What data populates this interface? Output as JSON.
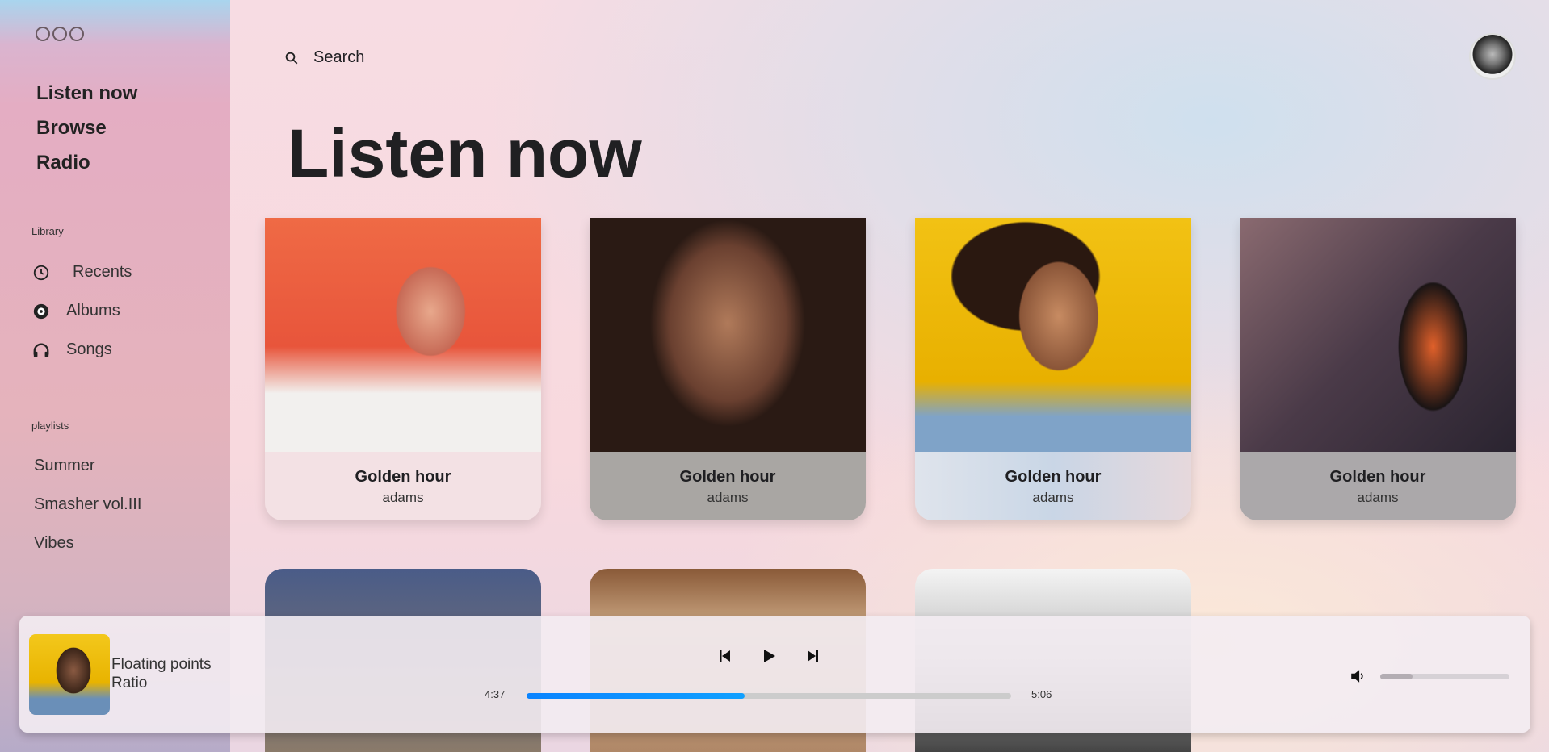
{
  "sidebar": {
    "nav": [
      "Listen now",
      "Browse",
      "Radio"
    ],
    "library_label": "Library",
    "library": [
      {
        "label": "Recents",
        "icon": "clock-icon"
      },
      {
        "label": "Albums",
        "icon": "disc-icon"
      },
      {
        "label": "Songs",
        "icon": "headphones-icon"
      }
    ],
    "playlists_label": "playlists",
    "playlists": [
      "Summer",
      "Smasher vol.III",
      "Vibes"
    ]
  },
  "header": {
    "search_label": "Search"
  },
  "main": {
    "title": "Listen now",
    "cards": [
      {
        "title": "Golden hour",
        "artist": "adams"
      },
      {
        "title": "Golden hour",
        "artist": "adams"
      },
      {
        "title": "Golden hour",
        "artist": "adams"
      },
      {
        "title": "Golden hour",
        "artist": "adams"
      }
    ]
  },
  "player": {
    "track": "Floating points",
    "artist": "Ratio",
    "elapsed": "4:37",
    "duration": "5:06",
    "progress": 0.45,
    "volume": 0.25,
    "accent": "#0a84ff"
  }
}
